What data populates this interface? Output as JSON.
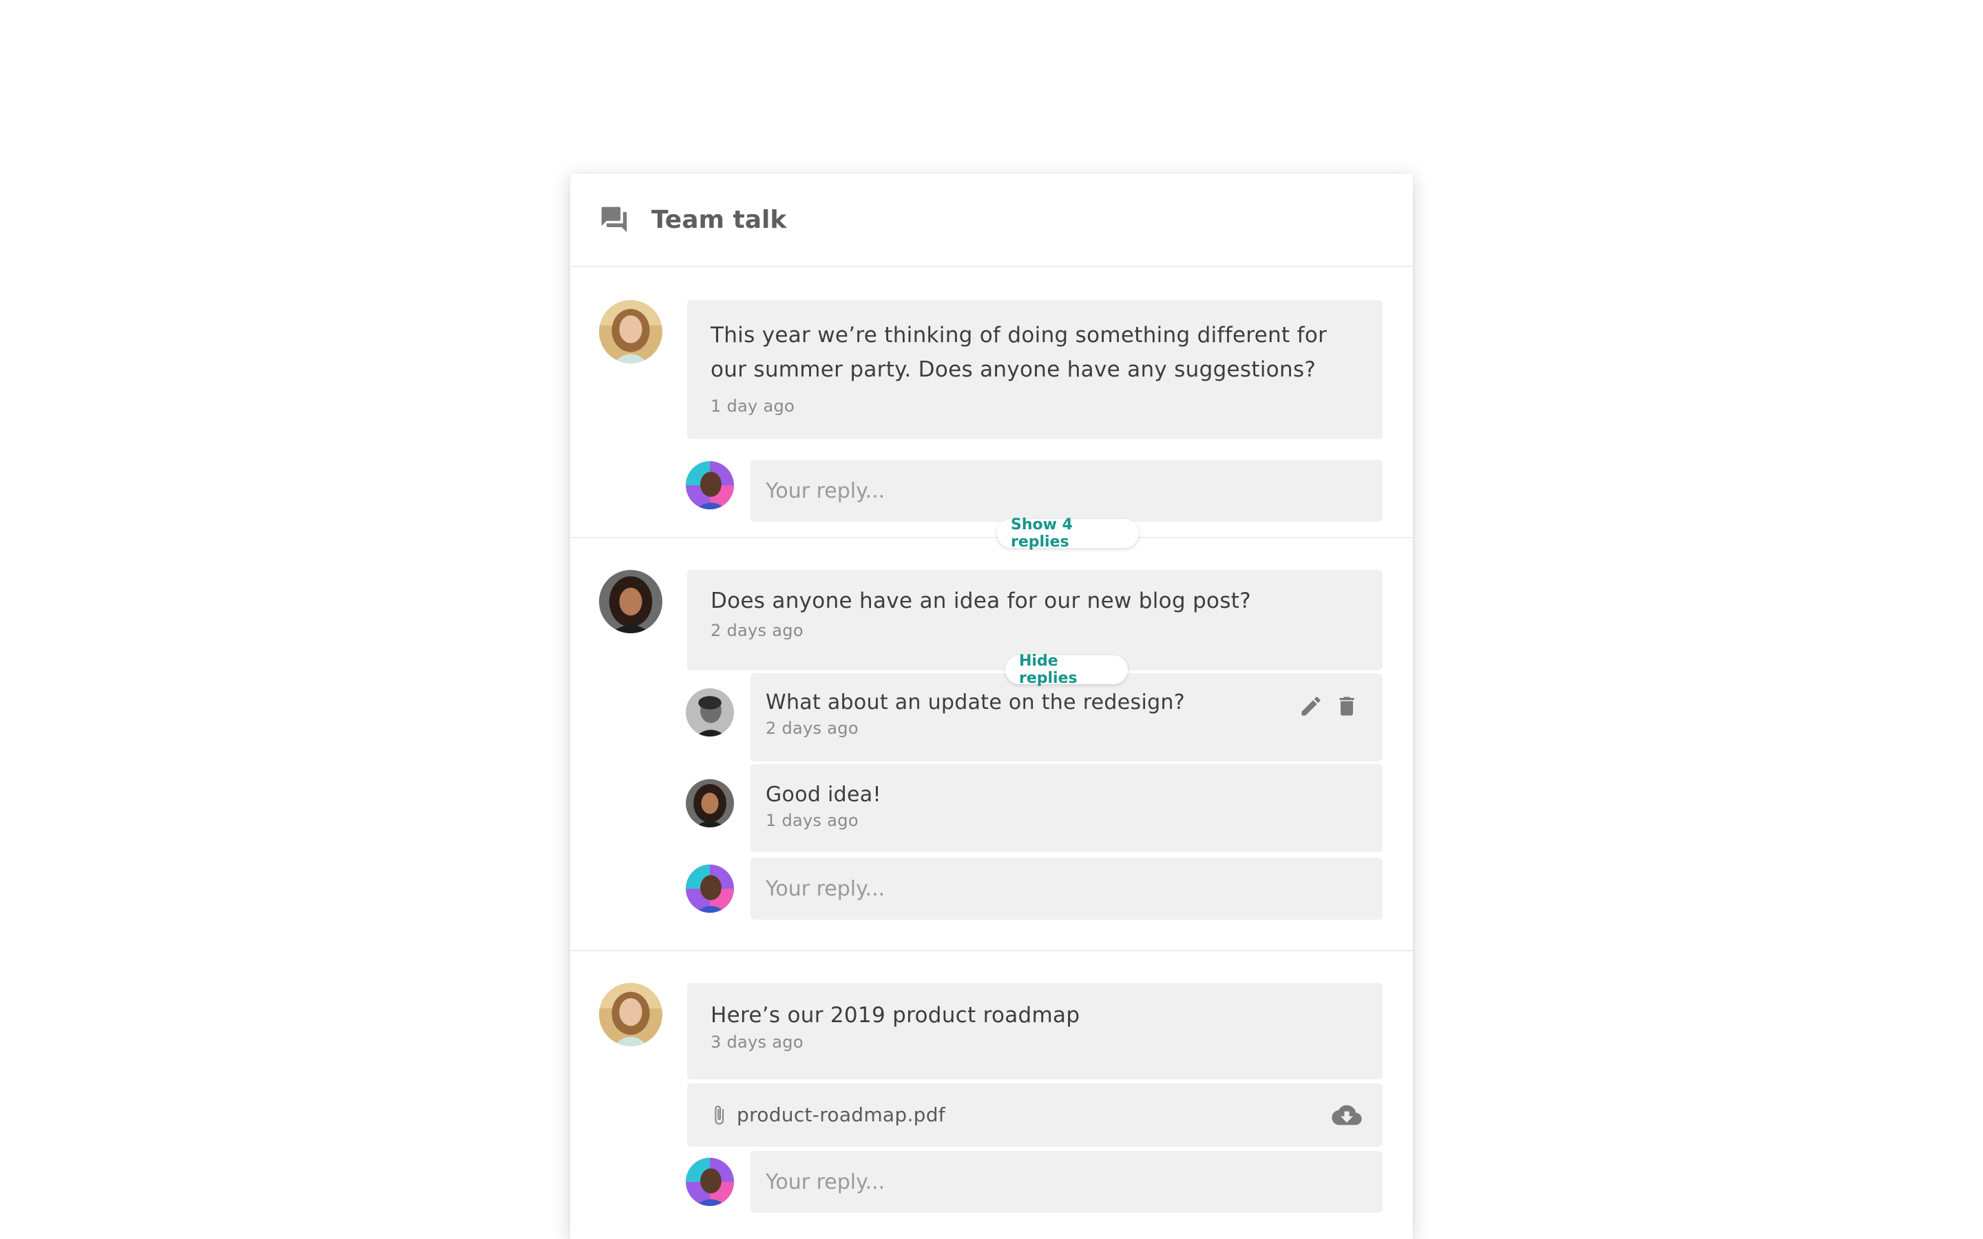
{
  "panel": {
    "title": "Team talk",
    "icon": "chat-bubbles-icon"
  },
  "threads": [
    {
      "message": "This year we’re thinking of doing something different for our summer party. Does anyone have any suggestions?",
      "time": "1 day ago",
      "toggle_label": "Show 4 replies",
      "reply_placeholder": "Your reply..."
    },
    {
      "message": "Does anyone have an idea for our new blog post?",
      "time": "2 days ago",
      "toggle_label": "Hide replies",
      "replies": [
        {
          "text": "What about an update on the redesign?",
          "time": "2 days ago"
        },
        {
          "text": "Good idea!",
          "time": "1 days ago"
        }
      ],
      "reply_placeholder": "Your reply..."
    },
    {
      "message": "Here’s our 2019 product roadmap",
      "time": "3 days ago",
      "attachment": {
        "filename": "product-roadmap.pdf"
      },
      "reply_placeholder": "Your reply..."
    }
  ],
  "colors": {
    "accent": "#15968c",
    "bubble": "#f0f0f0",
    "divider": "#eeeeee",
    "icon_gray": "#7a7a7a"
  }
}
